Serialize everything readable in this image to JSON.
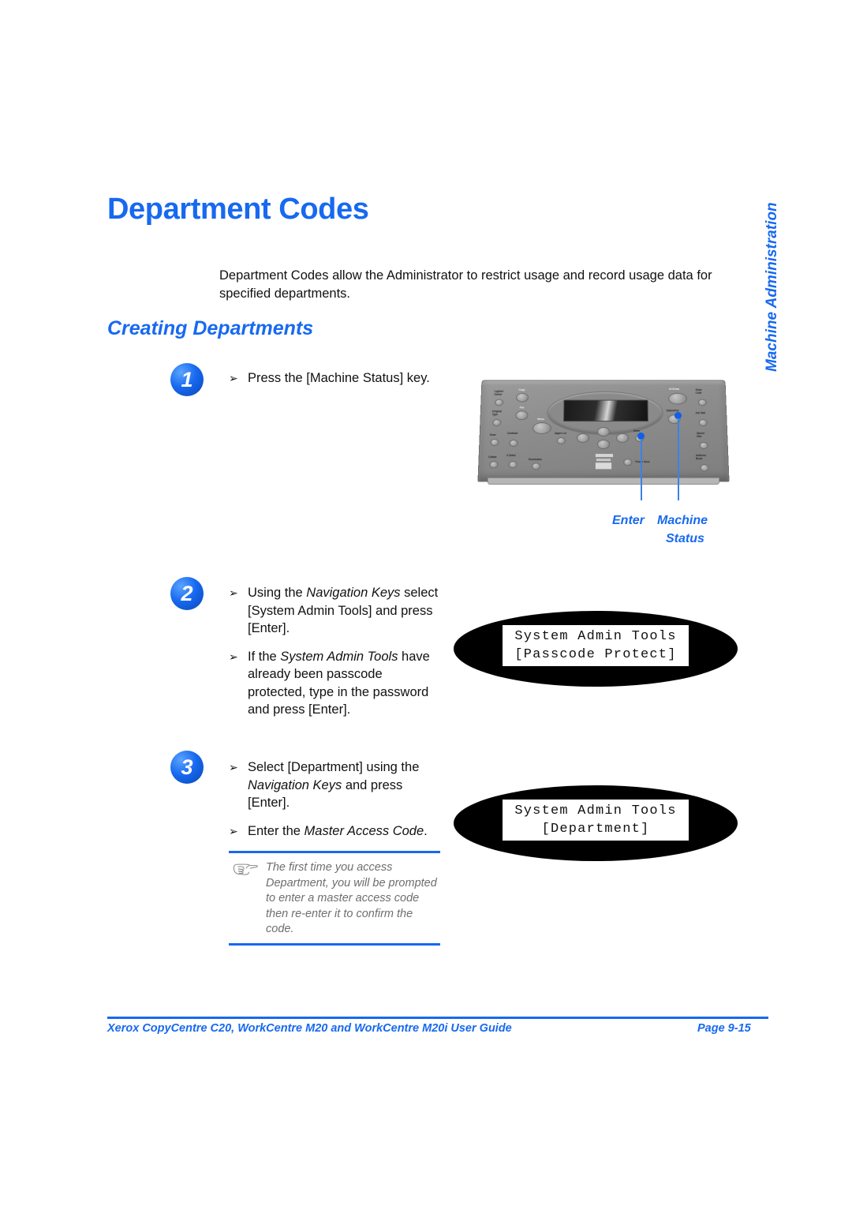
{
  "document": {
    "title": "Department Codes",
    "section_title": "Creating Departments",
    "side_tab": "Machine Administration",
    "intro": "Department Codes allow the Administrator to restrict usage and record usage data for specified departments.",
    "accent_color": "#1769f0",
    "text_color": "#111111",
    "note_text_color": "#6e6e6e"
  },
  "steps": [
    {
      "number": "1",
      "bullets": [
        {
          "mark": "➢",
          "text": "Press the [Machine Status] key."
        }
      ]
    },
    {
      "number": "2",
      "bullets": [
        {
          "mark": "➢",
          "pre": "Using the ",
          "em": "Navigation Keys",
          "post": " select [System Admin Tools] and press [Enter]."
        },
        {
          "mark": "➢",
          "pre": "If the ",
          "em": "System Admin Tools",
          "post": " have already been passcode protected, type in the password and press [Enter]."
        }
      ]
    },
    {
      "number": "3",
      "bullets": [
        {
          "mark": "➢",
          "pre": "Select [Department] using the ",
          "em": "Navigation Keys",
          "post": " and press [Enter]."
        },
        {
          "mark": "➢",
          "pre": "Enter the ",
          "em": "Master Access Code",
          "post": "."
        }
      ]
    }
  ],
  "control_panel": {
    "callouts": [
      {
        "name": "enter",
        "label": "Enter"
      },
      {
        "name": "machine-status",
        "label_line1": "Machine",
        "label_line2": "Status"
      }
    ],
    "buttons": [
      "Lighter/Darker",
      "Copy",
      "Original Type",
      "Fax",
      "Contrast",
      "Resolution",
      "Reduce/Enlarge",
      "2 Sided",
      "Collate",
      "Scan",
      "Menu",
      "Enter",
      "Upper Level",
      "AC/Clear",
      "Stop/Clear",
      "Status/Fax",
      "Job Status",
      "Speed Dial",
      "Address Book",
      "Redial/Pause",
      "Start",
      "Power Save"
    ]
  },
  "lcd_displays": [
    {
      "name": "passcode-protect",
      "line1": "System Admin Tools",
      "line2": "[Passcode Protect]"
    },
    {
      "name": "department",
      "line1": "System Admin Tools",
      "line2": "[Department]"
    }
  ],
  "note": {
    "icon": "pointing-hand-icon",
    "text": "The first time you access Department, you will be prompted to enter a master access code then re-enter it to confirm the code."
  },
  "footer": {
    "left": "Xerox CopyCentre C20, WorkCentre M20 and WorkCentre M20i User Guide",
    "right": "Page 9-15"
  }
}
